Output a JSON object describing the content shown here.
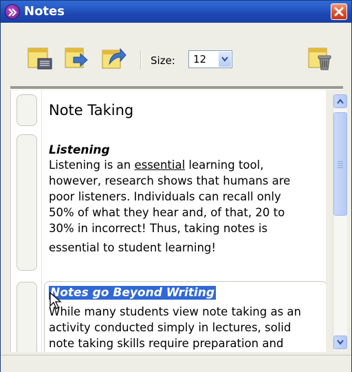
{
  "window": {
    "title": "Notes",
    "close_icon": "close-icon",
    "app_icon": "app-chevron-icon"
  },
  "toolbar": {
    "buttons": [
      {
        "icon": "new-note-icon"
      },
      {
        "icon": "import-note-icon"
      },
      {
        "icon": "export-note-icon"
      }
    ],
    "size_label": "Size:",
    "size_value": "12",
    "trash_icon": "trash-icon"
  },
  "note": {
    "heading": "Note Taking",
    "section1_title": "Listening",
    "section1_lines": [
      [
        "Listening is an ",
        "essential",
        " learning tool,"
      ],
      "however, research shows that humans are",
      "poor listeners. Individuals can recall only",
      "50% of what they hear and, of that, 20 to",
      "30% in incorrect! Thus, taking notes is",
      "essential to student learning!"
    ],
    "section2_title": "Notes go Beyond Writing",
    "section2_lines": [
      "While many students view note taking as an",
      "activity conducted simply in lectures, solid",
      "note taking skills require preparation and"
    ]
  },
  "colors": {
    "titlebar": "#1e48b4",
    "selection": "#3168d5",
    "close": "#e0532c"
  }
}
